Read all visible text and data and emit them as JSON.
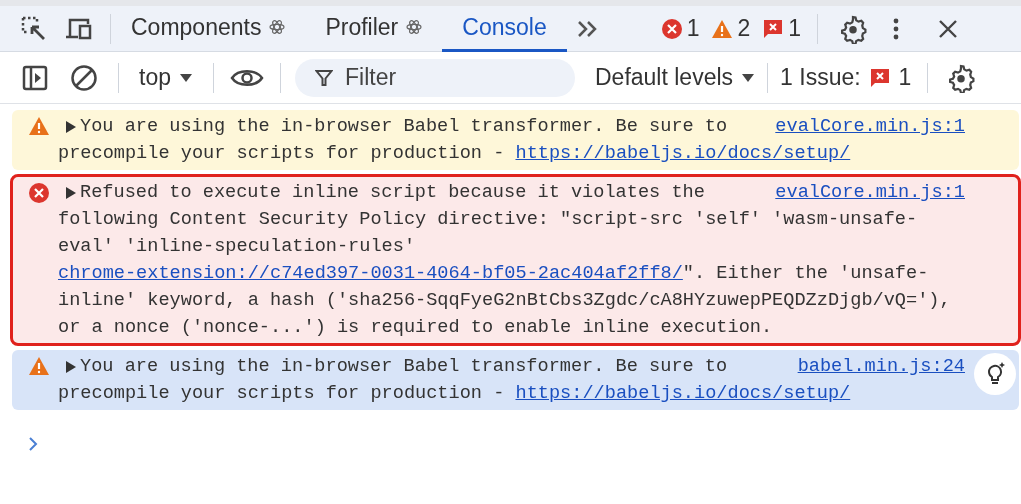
{
  "tabs": [
    {
      "label": "Components",
      "react": true,
      "selected": false
    },
    {
      "label": "Profiler",
      "react": true,
      "selected": false
    },
    {
      "label": "Console",
      "react": false,
      "selected": true
    }
  ],
  "counts": [
    {
      "kind": "error",
      "count": "1"
    },
    {
      "kind": "warning",
      "count": "2"
    },
    {
      "kind": "issue",
      "count": "1"
    }
  ],
  "toolbar": {
    "context": "top",
    "filter_placeholder": "Filter",
    "levels": "Default levels",
    "issues_label": "1 Issue:",
    "issues_count": "1"
  },
  "messages": [
    {
      "kind": "warning",
      "selected": false,
      "outlined": false,
      "source": "evalCore.min.js:1",
      "lines": [
        [
          {
            "text": "You are using the in-browser Babel transformer. Be sure to",
            "link": false
          }
        ],
        [
          {
            "text": "precompile your scripts for production - ",
            "link": false
          },
          {
            "text": "https://babeljs.io/docs/setup/",
            "link": true
          }
        ]
      ]
    },
    {
      "kind": "error",
      "selected": false,
      "outlined": true,
      "source": "evalCore.min.js:1",
      "lines": [
        [
          {
            "text": "Refused to execute inline script because it violates the",
            "link": false
          }
        ],
        [
          {
            "text": "following Content Security Policy directive: \"script-src 'self' 'wasm-unsafe-",
            "link": false
          }
        ],
        [
          {
            "text": "eval' 'inline-speculation-rules'",
            "link": false
          }
        ],
        [
          {
            "text": "chrome-extension://c74ed397-0031-4064-bf05-2ac404af2ff8/",
            "link": true
          },
          {
            "text": "\". Either the 'unsafe-",
            "link": false
          }
        ],
        [
          {
            "text": "inline' keyword, a hash ('sha256-SqqFyeG2nBtCbs3Zgdc/cA8HYzuwepPEQDZzDjgb/vQ='),",
            "link": false
          }
        ],
        [
          {
            "text": "or a nonce ('nonce-...') is required to enable inline execution.",
            "link": false
          }
        ]
      ]
    },
    {
      "kind": "warning",
      "selected": true,
      "outlined": false,
      "source": "babel.min.js:24",
      "lines": [
        [
          {
            "text": "You are using the in-browser Babel transformer. Be sure to",
            "link": false
          }
        ],
        [
          {
            "text": "precompile your scripts for production - ",
            "link": false
          },
          {
            "text": "https://babeljs.io/docs/setup/",
            "link": true
          }
        ]
      ]
    }
  ]
}
